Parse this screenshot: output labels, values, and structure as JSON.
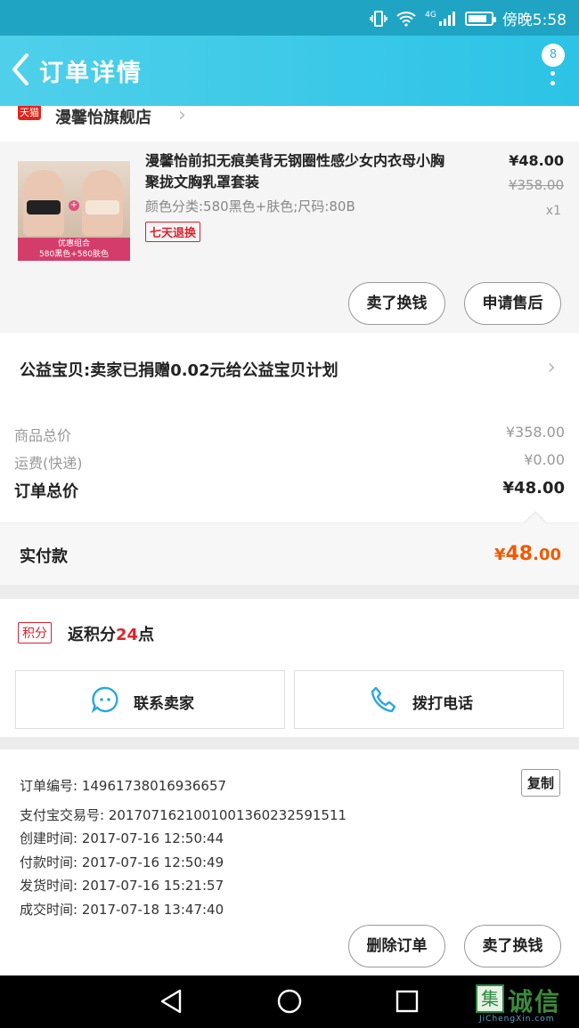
{
  "status_bar": {
    "time": "傍晚5:58",
    "network": "4G",
    "battery_level": 0.85
  },
  "nav": {
    "title": "订单详情",
    "badge": "8"
  },
  "store": {
    "platform_tag": "天猫",
    "name": "漫馨怡旗舰店"
  },
  "item": {
    "title": "漫馨怡前扣无痕美背无钢圈性感少女内衣母小胸聚拢文胸乳罩套装",
    "spec": "颜色分类:580黑色+肤色;尺码:80B",
    "tag": "七天退换",
    "price": "¥48.00",
    "original_price": "¥358.00",
    "quantity": "x1",
    "thumb_caption_1": "优惠组合",
    "thumb_caption_2": "580黑色+580肤色",
    "buttons": [
      "卖了换钱",
      "申请售后"
    ]
  },
  "charity": {
    "text": "公益宝贝:卖家已捐赠0.02元给公益宝贝计划"
  },
  "totals": {
    "goods_label": "商品总价",
    "goods_value": "¥358.00",
    "shipping_label": "运费(快递)",
    "shipping_value": "¥0.00",
    "order_label": "订单总价",
    "order_value": "¥48.00",
    "paid_label": "实付款",
    "paid_currency": "¥",
    "paid_int": "48",
    "paid_dec": ".00"
  },
  "points": {
    "tag": "积分",
    "prefix": "返积分",
    "count": "24",
    "suffix": "点"
  },
  "contact": {
    "seller": "联系卖家",
    "phone": "拨打电话"
  },
  "order_info": {
    "order_no": "订单编号: 14961738016936657",
    "copy": "复制",
    "alipay_no": "支付宝交易号: 2017071621001001360232591511",
    "created": "创建时间: 2017-07-16 12:50:44",
    "paid": "付款时间: 2017-07-16 12:50:49",
    "shipped": "发货时间: 2017-07-16 15:21:57",
    "completed": "成交时间: 2017-07-18 13:47:40"
  },
  "bottom_actions": [
    "删除订单",
    "卖了换钱"
  ],
  "watermark": {
    "mark": "集",
    "name": "诚信",
    "url": "JiChengXin.com"
  }
}
